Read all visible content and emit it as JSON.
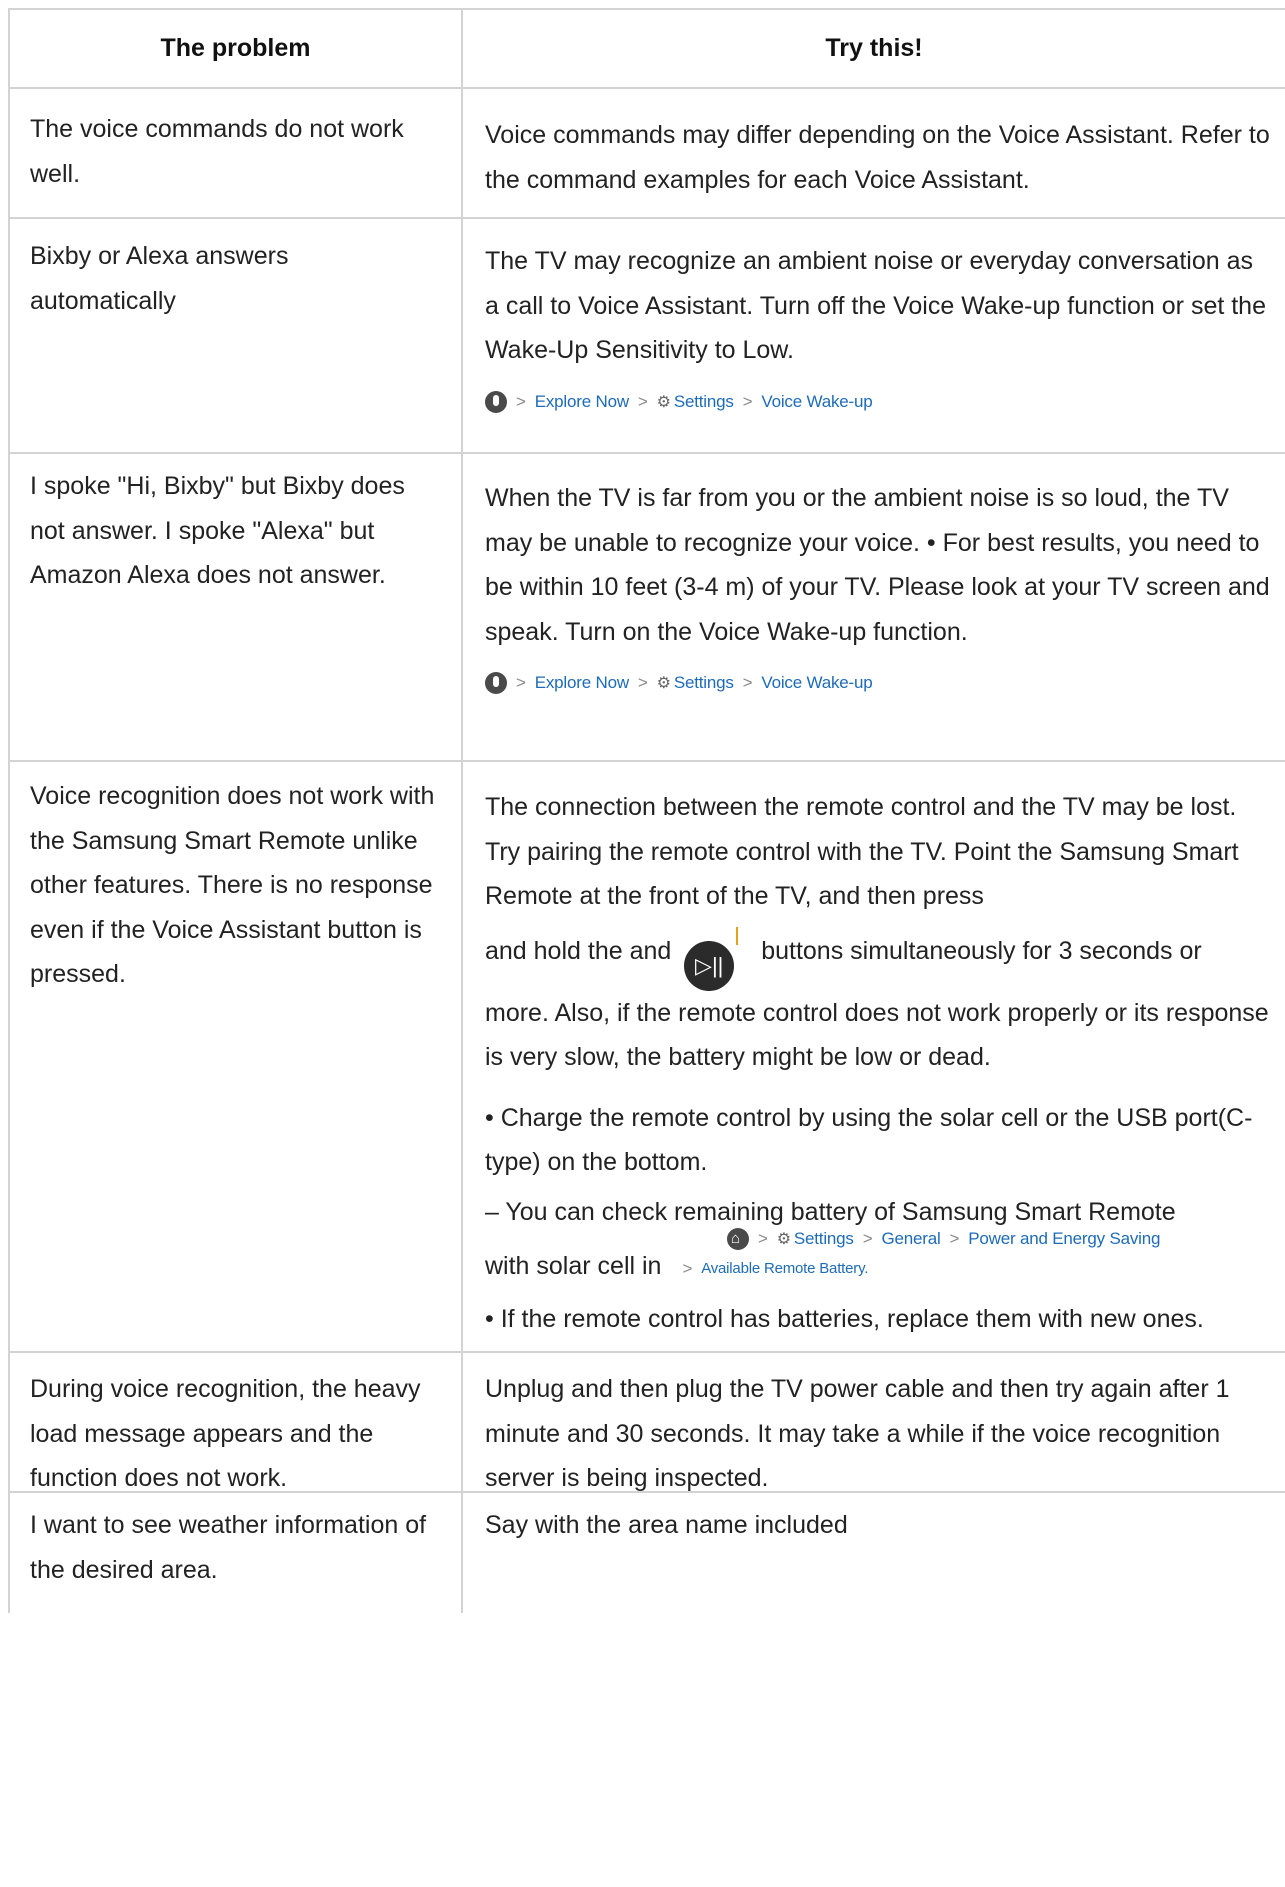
{
  "table": {
    "headers": [
      "The problem",
      "Try this!"
    ],
    "rows": [
      {
        "problem": "The voice commands do not work well.",
        "solution": "Voice commands may differ depending on the Voice Assistant. Refer to the command examples for each Voice Assistant."
      },
      {
        "problem": "Bixby or Alexa answers automatically",
        "solution": "The TV may recognize an ambient noise or everyday conversation as a call to Voice Assistant. Turn off the Voice Wake-up function or set the Wake-Up Sensitivity to Low.",
        "path": [
          "Explore Now",
          "Settings",
          "Voice Wake-up"
        ]
      },
      {
        "problem": "I spoke \"Hi, Bixby\" but Bixby does not answer. I spoke \"Alexa\" but Amazon Alexa does not answer.",
        "solution": "When the TV is far from you or the ambient noise is so loud, the TV may be unable to recognize your voice. • For best results, you need to be within 10 feet (3-4 m) of your TV. Please look at your TV screen and speak. Turn on the Voice Wake-up function.",
        "path": [
          "Explore Now",
          "Settings",
          "Voice Wake-up"
        ]
      },
      {
        "problem": "Voice recognition does not work with the Samsung Smart Remote unlike other features. There is no response even if the Voice Assistant button is pressed.",
        "solution_a": "The connection between the remote control and the TV may be lost. Try pairing the remote control with the TV. Point the Samsung Smart Remote at the front of the TV, and then press",
        "solution_b_pre": "and hold the and",
        "solution_b_post": "buttons simultaneously for 3 seconds or more. Also, if the remote control does not work properly or its response is very slow, the battery might be low or dead.",
        "bullet1": "• Charge the remote control by using the solar cell or the USB port(C-type) on the bottom.",
        "dash1": "– You can check remaining battery of Samsung Smart Remote",
        "dash1_end": "with solar cell in",
        "path": [
          "Settings",
          "General",
          "Power and Energy Saving"
        ],
        "path_tail": "Available Remote Battery.",
        "bullet2": "• If the remote control has batteries, replace them with new ones."
      },
      {
        "problem": "During voice recognition, the heavy load message appears and the function does not work.",
        "solution": "Unplug and then plug the TV power cable and then try again after 1 minute and 30 seconds. It may take a while if the voice recognition server is being inspected."
      },
      {
        "problem": "I want to see weather information of the desired area.",
        "solution": "Say with the area name included"
      }
    ]
  },
  "icons": {
    "sep": ">",
    "gear": "⚙",
    "play": "▷||"
  },
  "colors": {
    "link": "#1e6bb8",
    "border": "#d3d3d3",
    "text": "#222222"
  }
}
